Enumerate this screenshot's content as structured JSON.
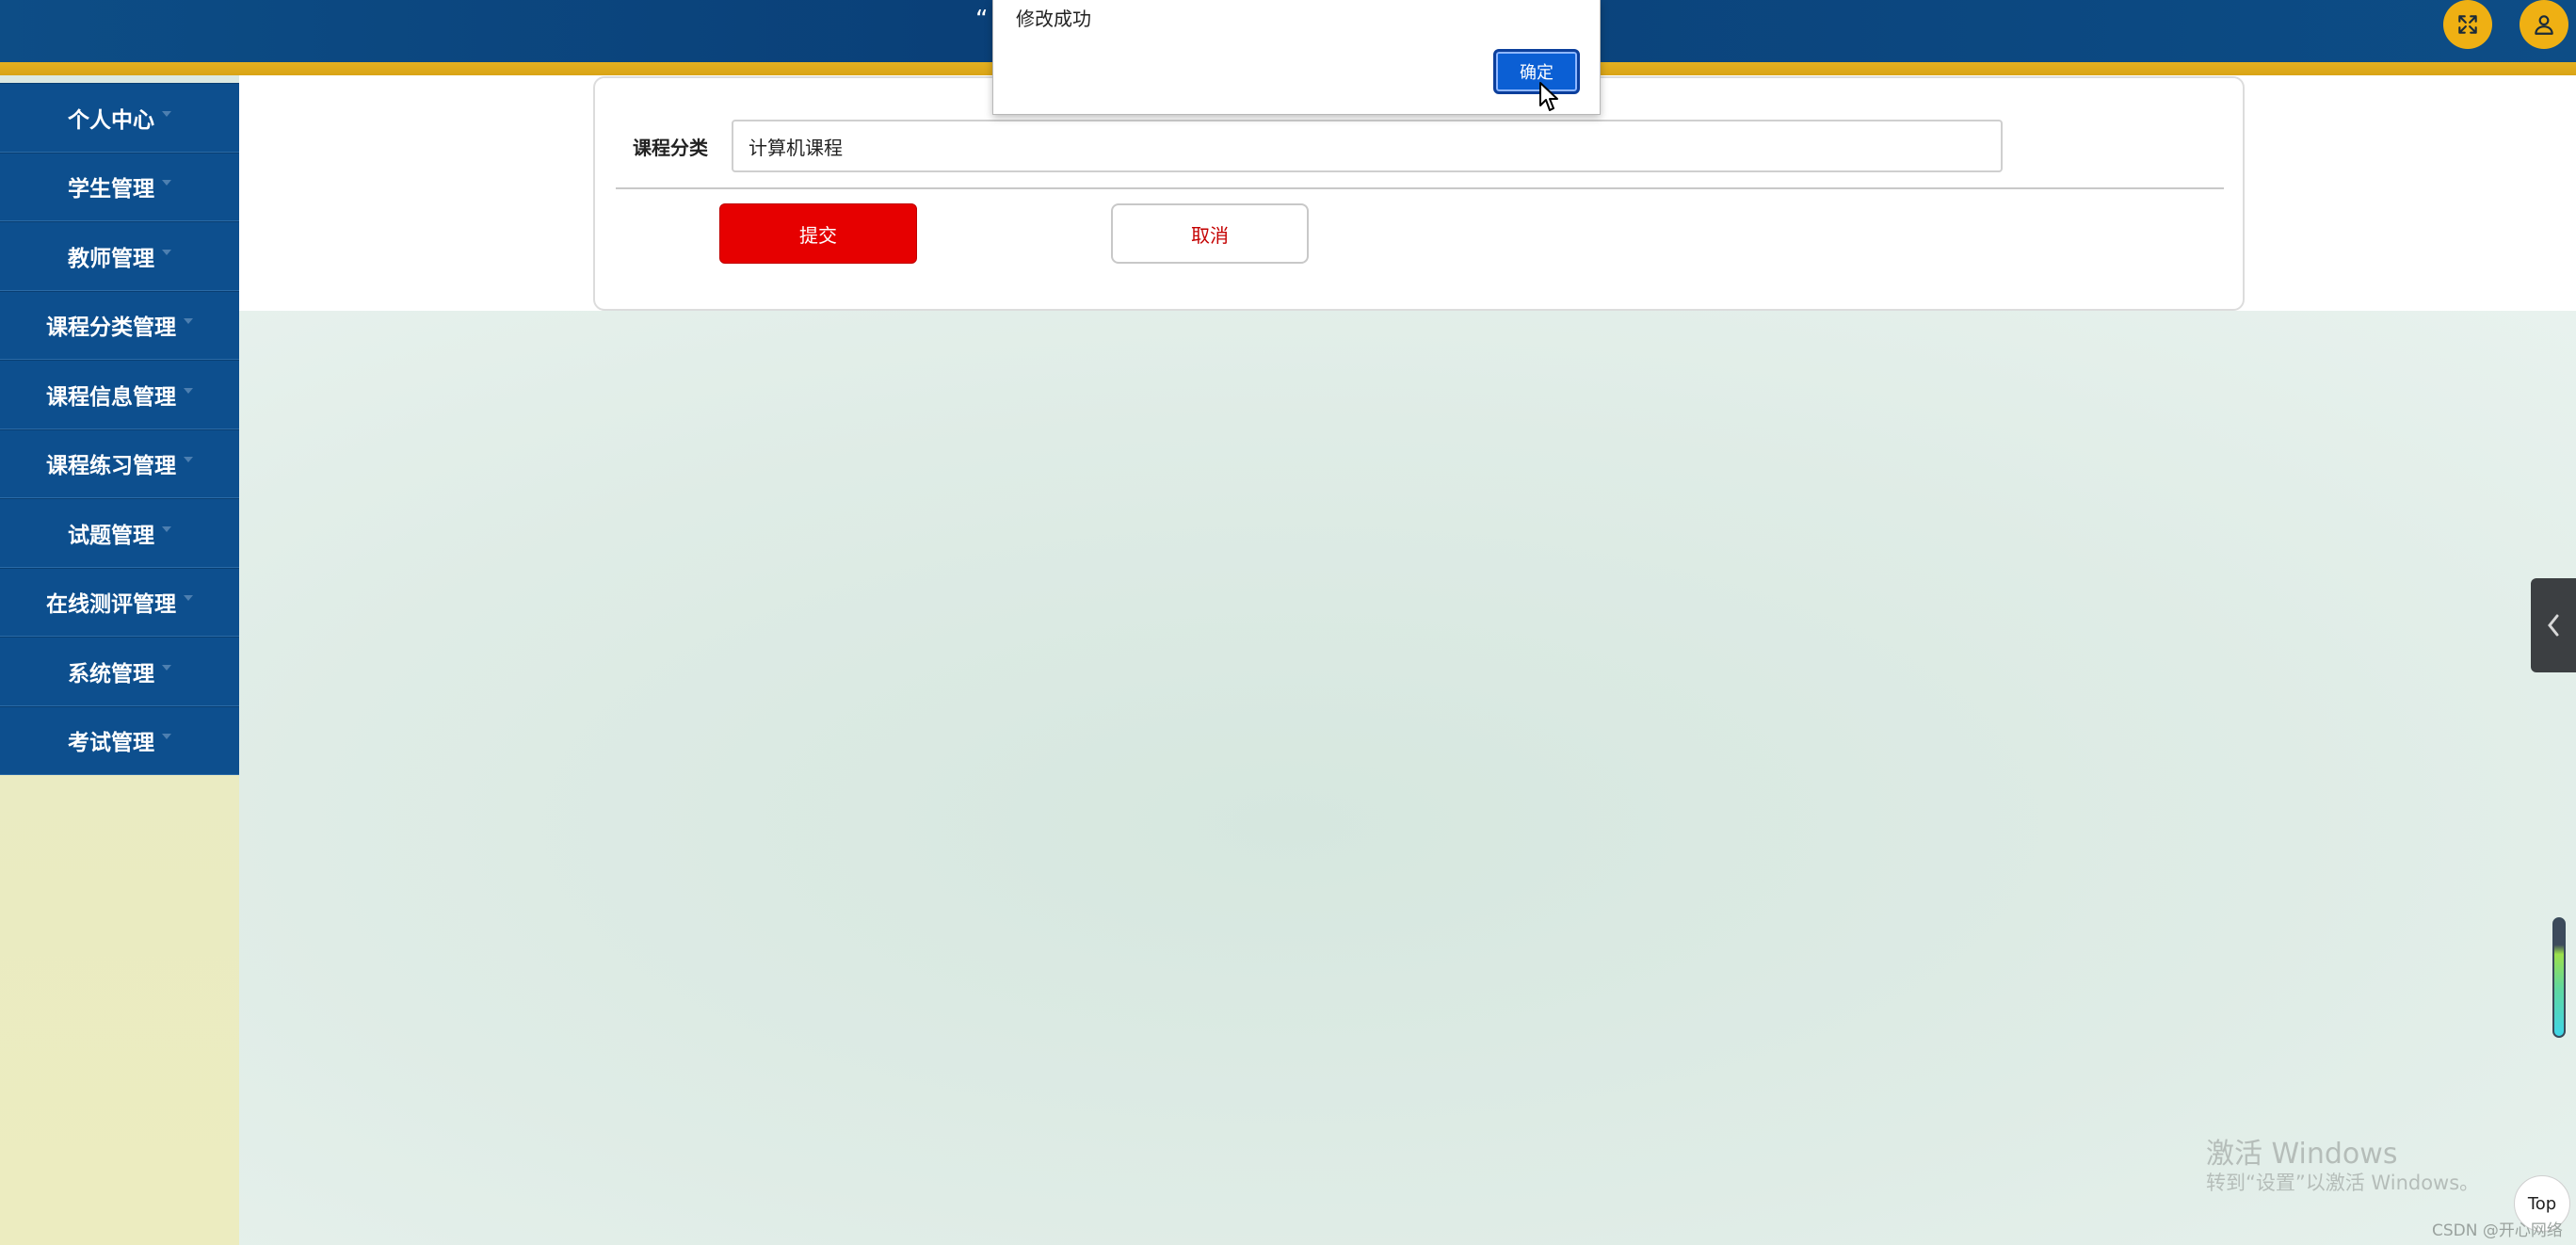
{
  "header": {
    "title": "“",
    "fullscreen_icon": "expand-arrows-icon",
    "user_icon": "user-icon"
  },
  "sidebar": {
    "items": [
      {
        "label": "个人中心"
      },
      {
        "label": "学生管理"
      },
      {
        "label": "教师管理"
      },
      {
        "label": "课程分类管理"
      },
      {
        "label": "课程信息管理"
      },
      {
        "label": "课程练习管理"
      },
      {
        "label": "试题管理"
      },
      {
        "label": "在线测评管理"
      },
      {
        "label": "系统管理"
      },
      {
        "label": "考试管理"
      }
    ]
  },
  "form": {
    "label": "课程分类",
    "value": "计算机课程",
    "submit_label": "提交",
    "cancel_label": "取消"
  },
  "alert": {
    "message": "修改成功",
    "ok_label": "确定"
  },
  "watermark": {
    "line1": "激活 Windows",
    "line2": "转到“设置”以激活 Windows。"
  },
  "top_button_label": "Top",
  "csdn_label": "CSDN @开心网络",
  "colors": {
    "header": "#0a3f77",
    "gold": "#e4b021",
    "sidebar_item": "#0d4f8e",
    "submit": "#e60000",
    "ok_button": "#0b5fd4"
  }
}
